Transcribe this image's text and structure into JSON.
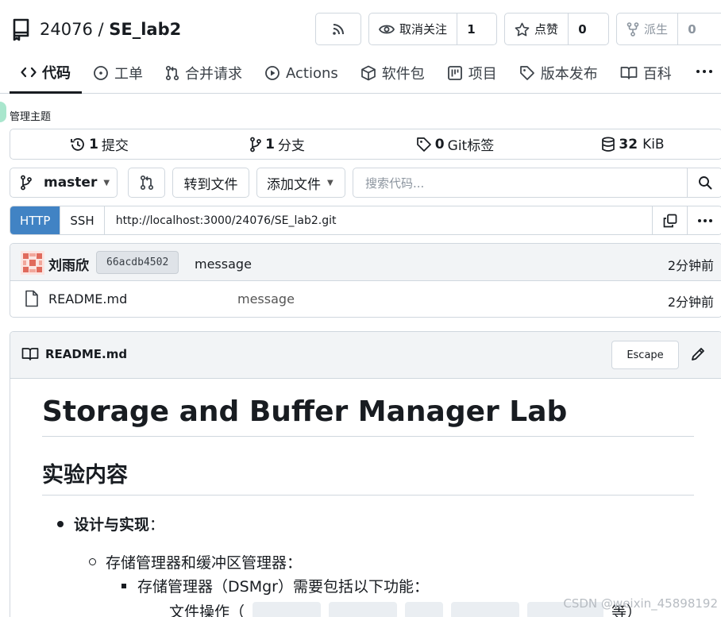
{
  "repo": {
    "owner": "24076",
    "separator": " / ",
    "name": "SE_lab2"
  },
  "header_buttons": {
    "unwatch": {
      "label": "取消关注",
      "count": "1"
    },
    "star": {
      "label": "点赞",
      "count": "0"
    },
    "fork": {
      "label": "派生",
      "count": "0"
    }
  },
  "tabs": [
    {
      "label": "代码",
      "icon": "code-icon"
    },
    {
      "label": "工单",
      "icon": "issue-icon"
    },
    {
      "label": "合并请求",
      "icon": "pull-request-icon"
    },
    {
      "label": "Actions",
      "icon": "play-icon"
    },
    {
      "label": "软件包",
      "icon": "package-icon"
    },
    {
      "label": "项目",
      "icon": "project-icon"
    },
    {
      "label": "版本发布",
      "icon": "tag-icon"
    },
    {
      "label": "百科",
      "icon": "book-icon"
    }
  ],
  "manage_topic": "管理主题",
  "stats": {
    "commits": {
      "num": "1",
      "label": "提交"
    },
    "branches": {
      "num": "1",
      "label": "分支"
    },
    "tags": {
      "num": "0",
      "label": "Git标签"
    },
    "size": {
      "num": "32",
      "label": "KiB"
    }
  },
  "toolbar": {
    "branch": "master",
    "goto_file": "转到文件",
    "add_file": "添加文件",
    "search_placeholder": "搜索代码..."
  },
  "clone": {
    "http": "HTTP",
    "ssh": "SSH",
    "url": "http://localhost:3000/24076/SE_lab2.git"
  },
  "commit": {
    "author": "刘雨欣",
    "sha": "66acdb4502",
    "message": "message",
    "time": "2分钟前"
  },
  "files": [
    {
      "name": "README.md",
      "message": "message",
      "time": "2分钟前"
    }
  ],
  "readme": {
    "filename": "README.md",
    "escape": "Escape",
    "h1": "Storage and Buffer Manager Lab",
    "h2": "实验内容",
    "item1_bold": "设计与实现",
    "item1_suffix": "：",
    "item2": "存储管理器和缓冲区管理器：",
    "item3": "存储管理器（DSMgr）需要包括以下功能：",
    "item4_prefix": "文件操作（",
    "item4_suffix": "等）"
  },
  "watermark": "CSDN @weixin_45898192"
}
